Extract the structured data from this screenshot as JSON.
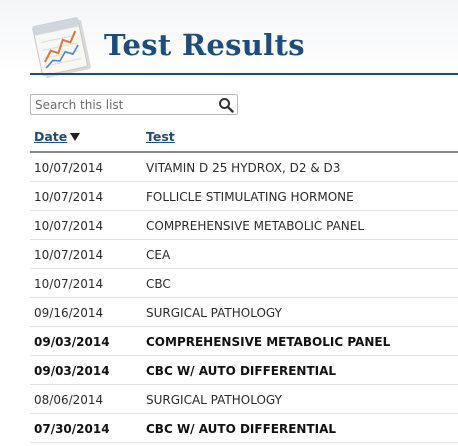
{
  "header": {
    "title": "Test Results",
    "icon": "test-results-chart-icon"
  },
  "search": {
    "placeholder": "Search this list",
    "value": "",
    "icon": "search-icon"
  },
  "columns": {
    "date_label": "Date",
    "test_label": "Test",
    "sort": {
      "column": "Date",
      "direction": "descending",
      "icon": "sort-down-icon"
    }
  },
  "results": [
    {
      "date": "10/07/2014",
      "test": "VITAMIN D 25 HYDROX, D2 & D3",
      "bold": false
    },
    {
      "date": "10/07/2014",
      "test": "FOLLICLE STIMULATING HORMONE",
      "bold": false
    },
    {
      "date": "10/07/2014",
      "test": "COMPREHENSIVE METABOLIC PANEL",
      "bold": false
    },
    {
      "date": "10/07/2014",
      "test": "CEA",
      "bold": false
    },
    {
      "date": "10/07/2014",
      "test": "CBC",
      "bold": false
    },
    {
      "date": "09/16/2014",
      "test": "SURGICAL PATHOLOGY",
      "bold": false
    },
    {
      "date": "09/03/2014",
      "test": "COMPREHENSIVE METABOLIC PANEL",
      "bold": true
    },
    {
      "date": "09/03/2014",
      "test": "CBC W/ AUTO DIFFERENTIAL",
      "bold": true
    },
    {
      "date": "08/06/2014",
      "test": "SURGICAL PATHOLOGY",
      "bold": false
    },
    {
      "date": "07/30/2014",
      "test": "CBC W/ AUTO DIFFERENTIAL",
      "bold": true
    }
  ],
  "colors": {
    "accent": "#1c4d7c",
    "text": "#2b2b2b",
    "row_divider": "#e2e2e2"
  }
}
